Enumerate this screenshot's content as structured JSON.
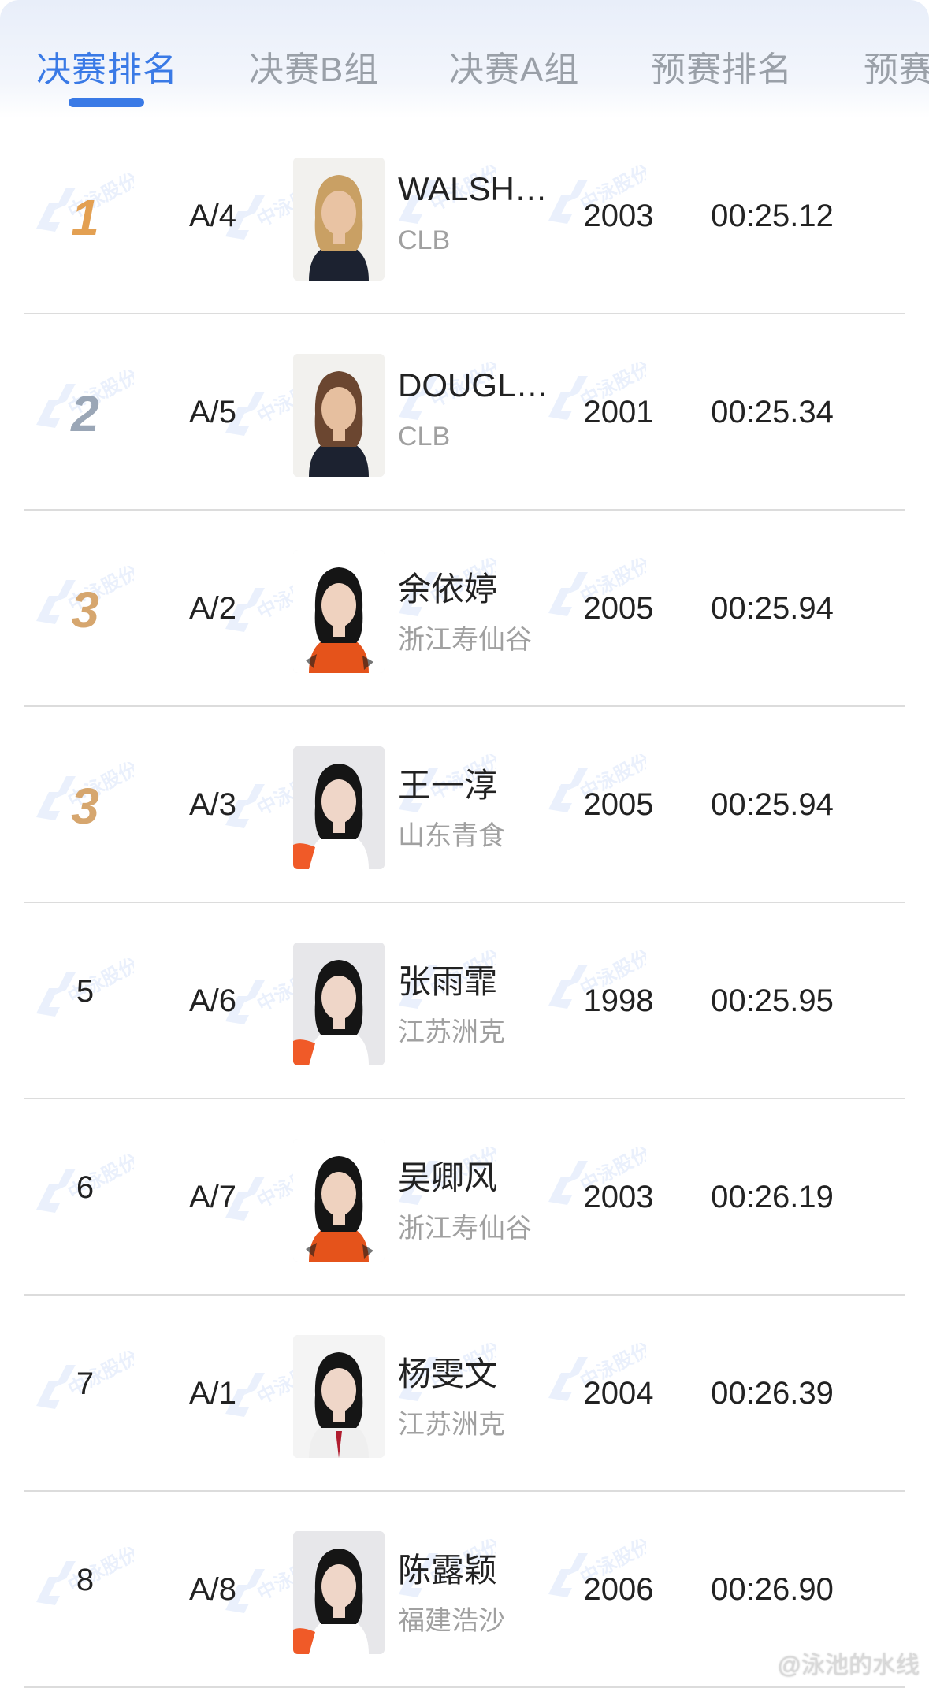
{
  "tabs": [
    {
      "label": "决赛排名",
      "active": true
    },
    {
      "label": "决赛B组",
      "active": false
    },
    {
      "label": "决赛A组",
      "active": false
    },
    {
      "label": "预赛排名",
      "active": false
    },
    {
      "label": "预赛",
      "active": false
    }
  ],
  "colors": {
    "accent": "#3a7ae6",
    "gold": "#e3a052",
    "silver": "#9aa6b6",
    "bronze": "#d6a66e",
    "divider": "#dcdcdc",
    "secondary_text": "#a0a0a0"
  },
  "rows": [
    {
      "rank": "1",
      "medal": "gold",
      "lane": "A/4",
      "name": "WALSH…",
      "team": "CLB",
      "year": "2003",
      "time": "00:25.12",
      "avatar": "portrait-blonde"
    },
    {
      "rank": "2",
      "medal": "silver",
      "lane": "A/5",
      "name": "DOUGL…",
      "team": "CLB",
      "year": "2001",
      "time": "00:25.34",
      "avatar": "portrait-brown"
    },
    {
      "rank": "3",
      "medal": "bronze",
      "lane": "A/2",
      "name": "余依婷",
      "team": "浙江寿仙谷",
      "year": "2005",
      "time": "00:25.94",
      "avatar": "portrait-orange"
    },
    {
      "rank": "3",
      "medal": "bronze",
      "lane": "A/3",
      "name": "王一淳",
      "team": "山东青食",
      "year": "2005",
      "time": "00:25.94",
      "avatar": "portrait-white"
    },
    {
      "rank": "5",
      "medal": "",
      "lane": "A/6",
      "name": "张雨霏",
      "team": "江苏洲克",
      "year": "1998",
      "time": "00:25.95",
      "avatar": "portrait-white"
    },
    {
      "rank": "6",
      "medal": "",
      "lane": "A/7",
      "name": "吴卿风",
      "team": "浙江寿仙谷",
      "year": "2003",
      "time": "00:26.19",
      "avatar": "portrait-orange"
    },
    {
      "rank": "7",
      "medal": "",
      "lane": "A/1",
      "name": "杨雯文",
      "team": "江苏洲克",
      "year": "2004",
      "time": "00:26.39",
      "avatar": "portrait-blazer"
    },
    {
      "rank": "8",
      "medal": "",
      "lane": "A/8",
      "name": "陈露颖",
      "team": "福建浩沙",
      "year": "2006",
      "time": "00:26.90",
      "avatar": "portrait-white"
    }
  ],
  "watermark": {
    "brand": "中泳股份",
    "footer": "@泳池的水线"
  }
}
